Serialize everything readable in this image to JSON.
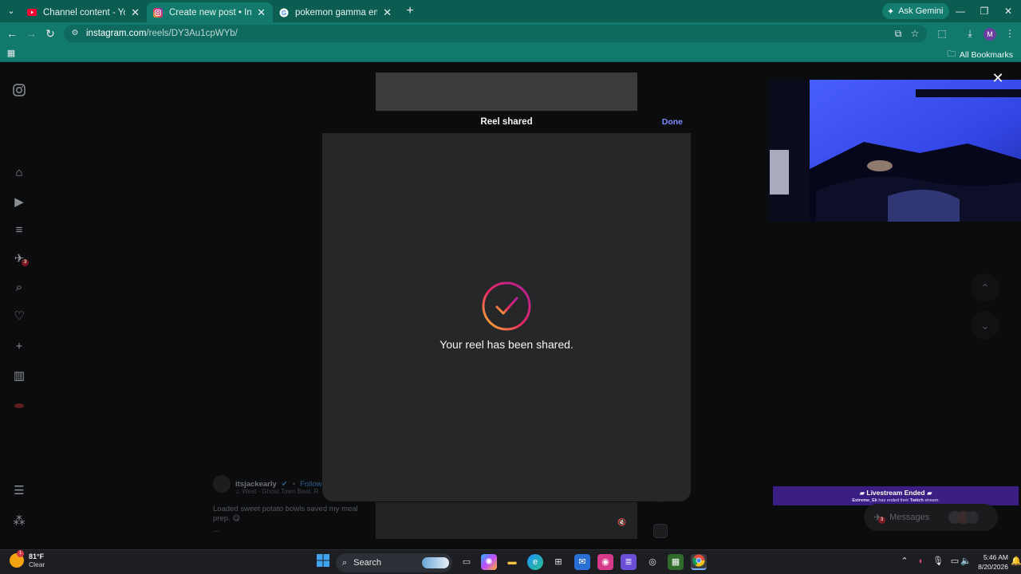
{
  "browser": {
    "tabs": [
      {
        "title": "Channel content - YouTube Stu",
        "active": false,
        "favicon": "youtube-icon"
      },
      {
        "title": "Create new post • Instagram",
        "active": true,
        "favicon": "instagram-icon"
      },
      {
        "title": "pokemon gamma emerald - Go",
        "active": false,
        "favicon": "google-icon"
      }
    ],
    "ask_gemini": "Ask Gemini",
    "url_host": "instagram.com",
    "url_path": "/reels/DY3Au1cpWYb/",
    "profile_initial": "M",
    "all_bookmarks": "All Bookmarks"
  },
  "sidebar": {
    "badges": {
      "messages": "3"
    }
  },
  "modal": {
    "title": "Reel shared",
    "done": "Done",
    "message": "Your reel has been shared."
  },
  "feed": {
    "username": "itsjackearly",
    "follow": "Follow",
    "audio": "West · Ghost Town Beat, R",
    "caption": "Loaded sweet potato bowls saved my meal prep. 😋",
    "more": "..."
  },
  "notification": {
    "title": "Livestream Ended",
    "subtitle_user": "Extreme_Ek",
    "subtitle_rest": "has ended their",
    "subtitle_platform": "Twitch",
    "subtitle_end": "stream."
  },
  "messages_button": {
    "label": "Messages",
    "badge": "3"
  },
  "taskbar": {
    "temp": "81°F",
    "condition": "Clear",
    "search": "Search",
    "time": "5:46 AM",
    "date": "8/20/2026",
    "weather_alert": "1"
  },
  "colors": {
    "tab_strip": "#0b5d52",
    "toolbar": "#117a6d",
    "modal_bg": "#262729",
    "done_link": "#7f8cff",
    "notification_bg": "#3a1e84"
  }
}
